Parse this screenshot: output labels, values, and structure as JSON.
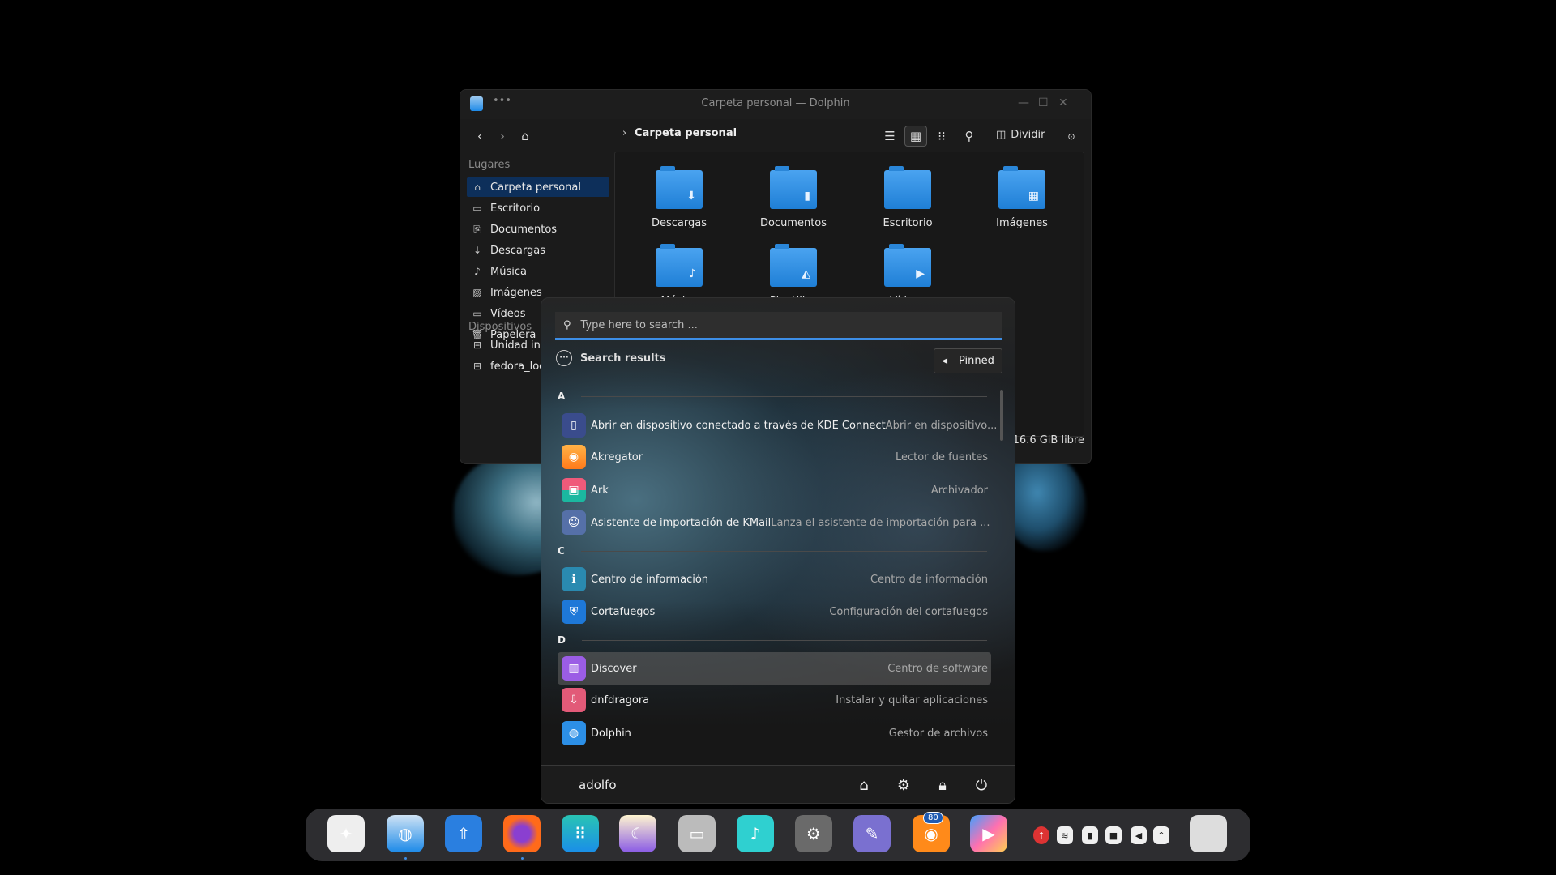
{
  "window": {
    "title": "Carpeta personal — Dolphin",
    "breadcrumb": "Carpeta personal",
    "split_label": "Dividir",
    "status": "16.6 GiB libre",
    "places_header": "Lugares",
    "devices_header": "Dispositivos",
    "places": [
      {
        "label": "Carpeta personal",
        "icon": "home-icon"
      },
      {
        "label": "Escritorio",
        "icon": "desktop-icon"
      },
      {
        "label": "Documentos",
        "icon": "documents-icon"
      },
      {
        "label": "Descargas",
        "icon": "download-icon"
      },
      {
        "label": "Música",
        "icon": "music-icon"
      },
      {
        "label": "Imágenes",
        "icon": "image-icon"
      },
      {
        "label": "Vídeos",
        "icon": "video-icon"
      },
      {
        "label": "Papelera",
        "icon": "trash-icon"
      }
    ],
    "devices": [
      {
        "label": "Unidad interna",
        "icon": "drive-icon"
      },
      {
        "label": "fedora_localhost-live",
        "icon": "drive-icon"
      }
    ],
    "files": [
      {
        "label": "Descargas"
      },
      {
        "label": "Documentos"
      },
      {
        "label": "Escritorio"
      },
      {
        "label": "Imágenes"
      },
      {
        "label": "Música"
      },
      {
        "label": "Plantillas"
      },
      {
        "label": "Vídeos"
      }
    ]
  },
  "launcher": {
    "search_placeholder": "Type here to search ...",
    "results_label": "Search results",
    "pinned_label": "Pinned",
    "user": "adolfo",
    "sections": [
      "A",
      "C",
      "D"
    ],
    "apps": [
      {
        "name": "Abrir en dispositivo conectado a través de KDE Connect",
        "desc": "Abrir en dispositivo..."
      },
      {
        "name": "Akregator",
        "desc": "Lector de fuentes"
      },
      {
        "name": "Ark",
        "desc": "Archivador"
      },
      {
        "name": "Asistente de importación de KMail",
        "desc": "Lanza el asistente de importación para ..."
      },
      {
        "name": "Centro de información",
        "desc": "Centro de información"
      },
      {
        "name": "Cortafuegos",
        "desc": "Configuración del cortafuegos"
      },
      {
        "name": "Discover",
        "desc": "Centro de software"
      },
      {
        "name": "dnfdragora",
        "desc": "Instalar y quitar aplicaciones"
      },
      {
        "name": "Dolphin",
        "desc": "Gestor de archivos"
      }
    ]
  },
  "dock": {
    "badge": "80",
    "accent": "#3d8ee6"
  }
}
